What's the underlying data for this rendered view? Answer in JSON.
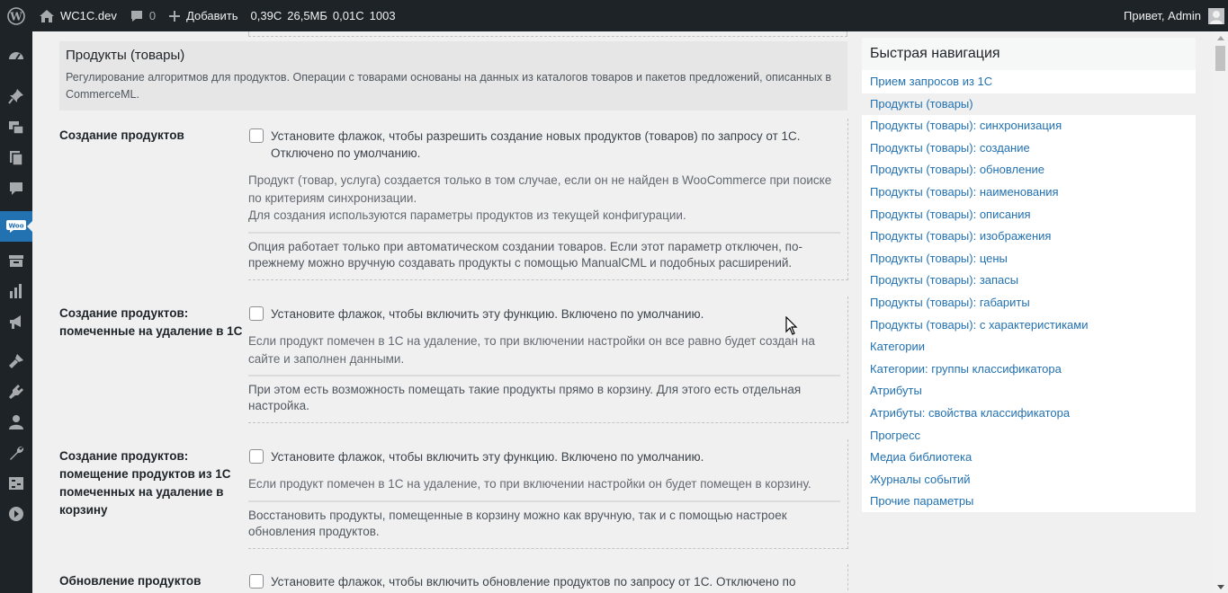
{
  "adminbar": {
    "site_name": "WC1C.dev",
    "comments_count": "0",
    "new_label": "Добавить",
    "stats": [
      "0,39С",
      "26,5МБ",
      "0,01С",
      "1003"
    ],
    "greeting": "Привет, Admin"
  },
  "section": {
    "title": "Продукты (товары)",
    "description": "Регулирование алгоритмов для продуктов. Операции с товарами основаны на данных из каталогов товаров и пакетов предложений, описанных в CommerceML."
  },
  "rows": [
    {
      "label": "Создание продуктов",
      "checkbox_text": "Установите флажок, чтобы разрешить создание новых продуктов (товаров) по запросу от 1С. Отключено по умолчанию.",
      "description": "Продукт (товар, услуга) создается только в том случае, если он не найден в WooCommerce при поиске по критериям синхронизации.",
      "description2": "Для создания используются параметры продуктов из текущей конфигурации.",
      "note": "Опция работает только при автоматическом создании товаров. Если этот параметр отключен, по-прежнему можно вручную создавать продукты с помощью ManualCML и подобных расширений."
    },
    {
      "label": "Создание продуктов: помеченные на удаление в 1С",
      "checkbox_text": "Установите флажок, чтобы включить эту функцию. Включено по умолчанию.",
      "description": "Если продукт помечен в 1С на удаление, то при включении настройки он все равно будет создан на сайте и заполнен данными.",
      "note": "При этом есть возможность помещать такие продукты прямо в корзину. Для этого есть отдельная настройка."
    },
    {
      "label": "Создание продуктов: помещение продуктов из 1С помеченных на удаление в корзину",
      "checkbox_text": "Установите флажок, чтобы включить эту функцию. Включено по умолчанию.",
      "description": "Если продукт помечен в 1С на удаление, то при включении настройки он будет помещен в корзину.",
      "note": "Восстановить продукты, помещенные в корзину можно как вручную, так и с помощью настроек обновления продуктов."
    },
    {
      "label": "Обновление продуктов",
      "checkbox_text": "Установите флажок, чтобы включить обновление продуктов по запросу от 1С. Отключено по"
    }
  ],
  "quicknav": {
    "title": "Быстрая навигация",
    "items": [
      "Прием запросов из 1С",
      "Продукты (товары)",
      "Продукты (товары): синхронизация",
      "Продукты (товары): создание",
      "Продукты (товары): обновление",
      "Продукты (товары): наименования",
      "Продукты (товары): описания",
      "Продукты (товары): изображения",
      "Продукты (товары): цены",
      "Продукты (товары): запасы",
      "Продукты (товары): габариты",
      "Продукты (товары): с характеристиками",
      "Категории",
      "Категории: группы классификатора",
      "Атрибуты",
      "Атрибуты: свойства классификатора",
      "Прогресс",
      "Медиа библиотека",
      "Журналы событий",
      "Прочие параметры"
    ],
    "active_index": 1
  },
  "menu_icons": [
    "dashboard-icon",
    "pin-icon",
    "media-icon",
    "pages-icon",
    "comments-icon",
    "woocommerce-icon",
    "products-icon",
    "analytics-icon",
    "marketing-icon",
    "appearance-icon",
    "plugins-icon",
    "users-icon",
    "tools-icon",
    "settings-icon",
    "collapse-icon"
  ],
  "colors": {
    "adminbar": "#1d2327",
    "accent": "#2271b1",
    "background": "#f0f0f1"
  }
}
